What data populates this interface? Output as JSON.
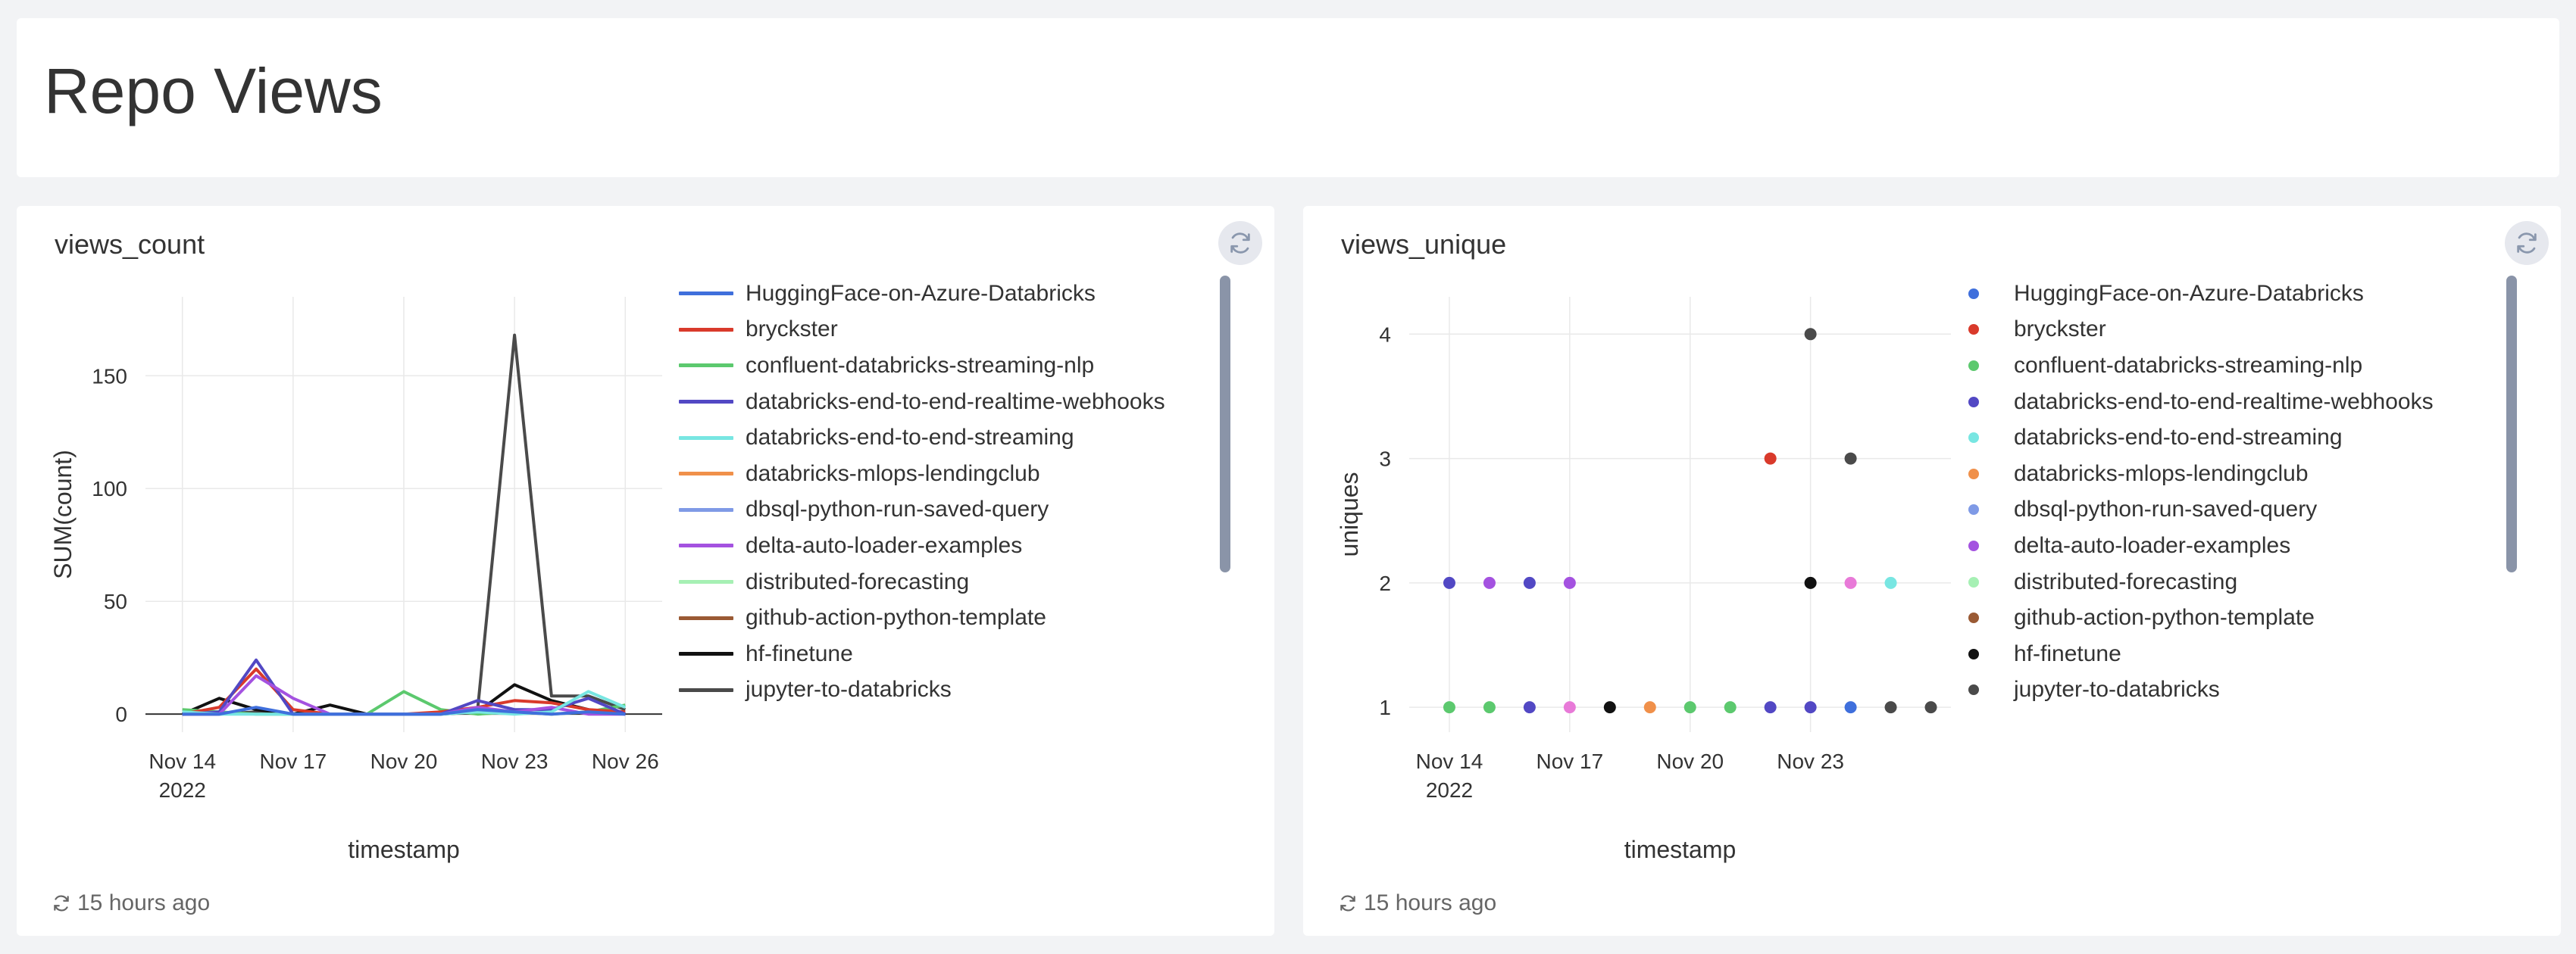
{
  "page": {
    "title": "Repo Views"
  },
  "colors": {
    "HuggingFace-on-Azure-Databricks": "#3f6fdc",
    "bryckster": "#d93a2b",
    "confluent-databricks-streaming-nlp": "#5cc96e",
    "databricks-end-to-end-realtime-webhooks": "#5248c4",
    "databricks-end-to-end-streaming": "#78e6e2",
    "databricks-mlops-lendingclub": "#f0904a",
    "dbsql-python-run-saved-query": "#7f9ae6",
    "delta-auto-loader-examples": "#a452e0",
    "distributed-forecasting": "#a6f0b4",
    "github-action-python-template": "#9a5a34",
    "hf-finetune": "#111111",
    "jupyter-to-databricks": "#4a4a4a",
    "pink-series": "#e87ad8"
  },
  "widgets": [
    {
      "title": "views_count",
      "refresh_icon": "refresh-icon",
      "footer": "15 hours ago",
      "legend": [
        "HuggingFace-on-Azure-Databricks",
        "bryckster",
        "confluent-databricks-streaming-nlp",
        "databricks-end-to-end-realtime-webhooks",
        "databricks-end-to-end-streaming",
        "databricks-mlops-lendingclub",
        "dbsql-python-run-saved-query",
        "delta-auto-loader-examples",
        "distributed-forecasting",
        "github-action-python-template",
        "hf-finetune",
        "jupyter-to-databricks"
      ]
    },
    {
      "title": "views_unique",
      "refresh_icon": "refresh-icon",
      "footer": "15 hours ago",
      "legend": [
        "HuggingFace-on-Azure-Databricks",
        "bryckster",
        "confluent-databricks-streaming-nlp",
        "databricks-end-to-end-realtime-webhooks",
        "databricks-end-to-end-streaming",
        "databricks-mlops-lendingclub",
        "dbsql-python-run-saved-query",
        "delta-auto-loader-examples",
        "distributed-forecasting",
        "github-action-python-template",
        "hf-finetune",
        "jupyter-to-databricks"
      ]
    }
  ],
  "chart_data": [
    {
      "type": "line",
      "title": "views_count",
      "xlabel": "timestamp",
      "ylabel": "SUM(count)",
      "xlim": [
        "2022-11-13",
        "2022-11-27"
      ],
      "ylim": [
        -8,
        185
      ],
      "yticks": [
        0,
        50,
        100,
        150
      ],
      "xticks": [
        {
          "date": "2022-11-14",
          "label": "Nov 14",
          "sublabel": "2022"
        },
        {
          "date": "2022-11-17",
          "label": "Nov 17",
          "sublabel": ""
        },
        {
          "date": "2022-11-20",
          "label": "Nov 20",
          "sublabel": ""
        },
        {
          "date": "2022-11-23",
          "label": "Nov 23",
          "sublabel": ""
        },
        {
          "date": "2022-11-26",
          "label": "Nov 26",
          "sublabel": ""
        }
      ],
      "grid": true,
      "legend_position": "right",
      "series": [
        {
          "name": "jupyter-to-databricks",
          "x": [
            "2022-11-14",
            "2022-11-15",
            "2022-11-16",
            "2022-11-17",
            "2022-11-18",
            "2022-11-19",
            "2022-11-20",
            "2022-11-21",
            "2022-11-22",
            "2022-11-23",
            "2022-11-24",
            "2022-11-25",
            "2022-11-26"
          ],
          "y": [
            0,
            0,
            1,
            0,
            0,
            0,
            0,
            0,
            2,
            168,
            8,
            8,
            2
          ]
        },
        {
          "name": "hf-finetune",
          "x": [
            "2022-11-14",
            "2022-11-15",
            "2022-11-16",
            "2022-11-17",
            "2022-11-18",
            "2022-11-19",
            "2022-11-20",
            "2022-11-21",
            "2022-11-22",
            "2022-11-23",
            "2022-11-24",
            "2022-11-25",
            "2022-11-26"
          ],
          "y": [
            0,
            7,
            2,
            0,
            4,
            0,
            0,
            0,
            1,
            13,
            6,
            2,
            0
          ]
        },
        {
          "name": "confluent-databricks-streaming-nlp",
          "x": [
            "2022-11-14",
            "2022-11-15",
            "2022-11-16",
            "2022-11-17",
            "2022-11-18",
            "2022-11-19",
            "2022-11-20",
            "2022-11-21",
            "2022-11-22",
            "2022-11-23",
            "2022-11-24",
            "2022-11-25",
            "2022-11-26"
          ],
          "y": [
            2,
            1,
            0,
            0,
            0,
            0,
            10,
            2,
            0,
            1,
            0,
            1,
            4
          ]
        },
        {
          "name": "bryckster",
          "x": [
            "2022-11-14",
            "2022-11-15",
            "2022-11-16",
            "2022-11-17",
            "2022-11-18",
            "2022-11-19",
            "2022-11-20",
            "2022-11-21",
            "2022-11-22",
            "2022-11-23",
            "2022-11-24",
            "2022-11-25",
            "2022-11-26"
          ],
          "y": [
            0,
            3,
            20,
            2,
            0,
            0,
            0,
            1,
            3,
            6,
            5,
            2,
            1
          ]
        },
        {
          "name": "databricks-end-to-end-realtime-webhooks",
          "x": [
            "2022-11-14",
            "2022-11-15",
            "2022-11-16",
            "2022-11-17",
            "2022-11-18",
            "2022-11-19",
            "2022-11-20",
            "2022-11-21",
            "2022-11-22",
            "2022-11-23",
            "2022-11-24",
            "2022-11-25",
            "2022-11-26"
          ],
          "y": [
            0,
            1,
            24,
            0,
            0,
            0,
            0,
            0,
            6,
            2,
            2,
            7,
            0
          ]
        },
        {
          "name": "delta-auto-loader-examples",
          "x": [
            "2022-11-14",
            "2022-11-15",
            "2022-11-16",
            "2022-11-17",
            "2022-11-18",
            "2022-11-19",
            "2022-11-20",
            "2022-11-21",
            "2022-11-22",
            "2022-11-23",
            "2022-11-24",
            "2022-11-25",
            "2022-11-26"
          ],
          "y": [
            0,
            0,
            17,
            7,
            0,
            0,
            0,
            0,
            3,
            1,
            3,
            0,
            0
          ]
        },
        {
          "name": "databricks-end-to-end-streaming",
          "x": [
            "2022-11-14",
            "2022-11-15",
            "2022-11-16",
            "2022-11-17",
            "2022-11-18",
            "2022-11-19",
            "2022-11-20",
            "2022-11-21",
            "2022-11-22",
            "2022-11-23",
            "2022-11-24",
            "2022-11-25",
            "2022-11-26"
          ],
          "y": [
            1,
            0,
            0,
            0,
            0,
            0,
            0,
            0,
            1,
            0,
            1,
            10,
            3
          ]
        },
        {
          "name": "HuggingFace-on-Azure-Databricks",
          "x": [
            "2022-11-14",
            "2022-11-15",
            "2022-11-16",
            "2022-11-17",
            "2022-11-18",
            "2022-11-19",
            "2022-11-20",
            "2022-11-21",
            "2022-11-22",
            "2022-11-23",
            "2022-11-24",
            "2022-11-25",
            "2022-11-26"
          ],
          "y": [
            0,
            0,
            3,
            0,
            0,
            0,
            0,
            0,
            2,
            1,
            0,
            1,
            0
          ]
        }
      ]
    },
    {
      "type": "scatter",
      "title": "views_unique",
      "xlabel": "timestamp",
      "ylabel": "uniques",
      "xlim": [
        "2022-11-13",
        "2022-11-26.5"
      ],
      "ylim": [
        0.8,
        4.3
      ],
      "yticks": [
        1,
        2,
        3,
        4
      ],
      "xticks": [
        {
          "date": "2022-11-14",
          "label": "Nov 14",
          "sublabel": "2022"
        },
        {
          "date": "2022-11-17",
          "label": "Nov 17",
          "sublabel": ""
        },
        {
          "date": "2022-11-20",
          "label": "Nov 20",
          "sublabel": ""
        },
        {
          "date": "2022-11-23",
          "label": "Nov 23",
          "sublabel": ""
        }
      ],
      "grid": true,
      "legend_position": "right",
      "points": [
        {
          "x": "2022-11-14",
          "y": 2,
          "series": "databricks-end-to-end-realtime-webhooks"
        },
        {
          "x": "2022-11-15",
          "y": 2,
          "series": "delta-auto-loader-examples"
        },
        {
          "x": "2022-11-16",
          "y": 2,
          "series": "databricks-end-to-end-realtime-webhooks"
        },
        {
          "x": "2022-11-17",
          "y": 2,
          "series": "delta-auto-loader-examples"
        },
        {
          "x": "2022-11-14",
          "y": 1,
          "series": "confluent-databricks-streaming-nlp"
        },
        {
          "x": "2022-11-15",
          "y": 1,
          "series": "confluent-databricks-streaming-nlp"
        },
        {
          "x": "2022-11-16",
          "y": 1,
          "series": "databricks-end-to-end-realtime-webhooks"
        },
        {
          "x": "2022-11-17",
          "y": 1,
          "series": "pink-series"
        },
        {
          "x": "2022-11-18",
          "y": 1,
          "series": "hf-finetune"
        },
        {
          "x": "2022-11-19",
          "y": 1,
          "series": "databricks-mlops-lendingclub"
        },
        {
          "x": "2022-11-20",
          "y": 1,
          "series": "confluent-databricks-streaming-nlp"
        },
        {
          "x": "2022-11-21",
          "y": 1,
          "series": "confluent-databricks-streaming-nlp"
        },
        {
          "x": "2022-11-22",
          "y": 1,
          "series": "databricks-end-to-end-realtime-webhooks"
        },
        {
          "x": "2022-11-23",
          "y": 1,
          "series": "databricks-end-to-end-realtime-webhooks"
        },
        {
          "x": "2022-11-24",
          "y": 1,
          "series": "HuggingFace-on-Azure-Databricks"
        },
        {
          "x": "2022-11-25",
          "y": 1,
          "series": "jupyter-to-databricks"
        },
        {
          "x": "2022-11-26",
          "y": 1,
          "series": "jupyter-to-databricks"
        },
        {
          "x": "2022-11-22",
          "y": 3,
          "series": "bryckster"
        },
        {
          "x": "2022-11-23",
          "y": 4,
          "series": "jupyter-to-databricks"
        },
        {
          "x": "2022-11-24",
          "y": 3,
          "series": "jupyter-to-databricks"
        },
        {
          "x": "2022-11-23",
          "y": 2,
          "series": "hf-finetune"
        },
        {
          "x": "2022-11-24",
          "y": 2,
          "series": "pink-series"
        },
        {
          "x": "2022-11-25",
          "y": 2,
          "series": "databricks-end-to-end-streaming"
        }
      ]
    }
  ]
}
